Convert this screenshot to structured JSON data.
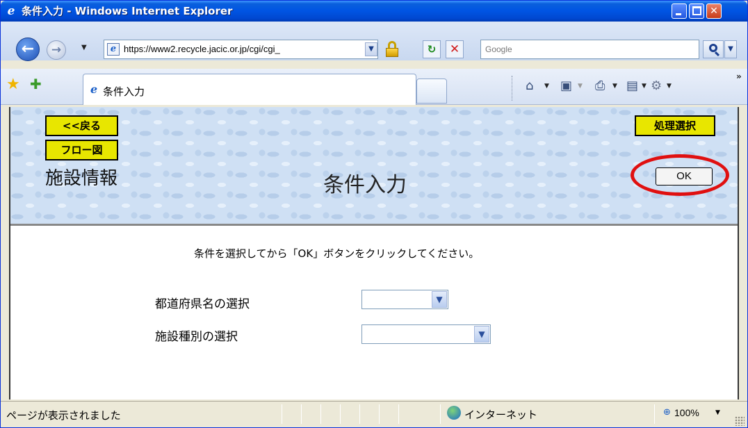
{
  "window": {
    "title": "条件入力 - Windows Internet Explorer"
  },
  "toolbar": {
    "url": "https://www2.recycle.jacic.or.jp/cgi/cgi_",
    "search_placeholder": "Google"
  },
  "tab": {
    "label": "条件入力"
  },
  "page": {
    "back_button": "<<戻る",
    "flow_button": "フロー図",
    "process_select_button": "処理選択",
    "section_title": "施設情報",
    "page_title": "条件入力",
    "ok_button": "OK",
    "instruction": "条件を選択してから「OK」ボタンをクリックしてください。",
    "fields": [
      {
        "label": "都道府県名の選択",
        "value": ""
      },
      {
        "label": "施設種別の選択",
        "value": ""
      }
    ]
  },
  "status": {
    "text": "ページが表示されました",
    "zone": "インターネット",
    "zoom": "100%"
  },
  "colors": {
    "titlebar": "#0054e3",
    "yellow_button": "#e8e600",
    "highlight_circle": "#e01010",
    "banner_bg": "#cfe0f4"
  },
  "icons": [
    "ie-icon",
    "back-arrow-icon",
    "forward-arrow-icon",
    "lock-icon",
    "refresh-icon",
    "stop-icon",
    "search-icon",
    "favorites-star-icon",
    "add-favorite-icon",
    "home-icon",
    "feeds-icon",
    "print-icon",
    "page-icon",
    "tools-icon",
    "globe-icon",
    "zoom-icon"
  ]
}
